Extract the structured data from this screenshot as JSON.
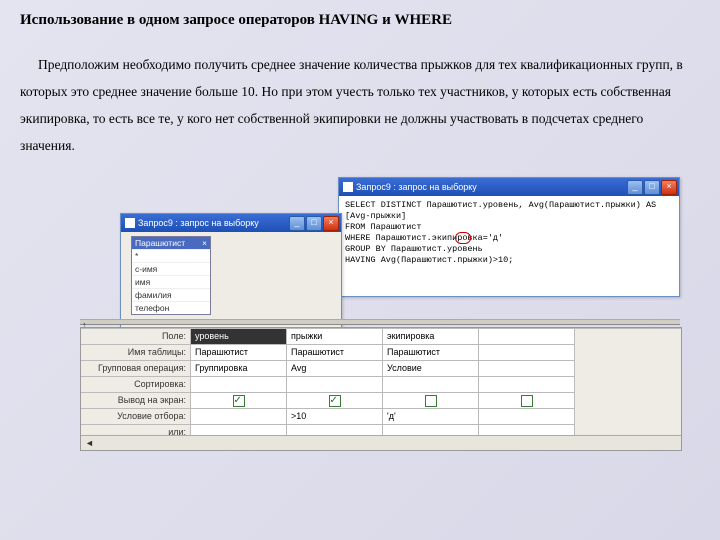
{
  "title": "Использование в одном запросе операторов HAVING и WHERE",
  "paragraph": "Предположим необходимо получить среднее значение количества прыжков для тех квалификационных групп, в которых это среднее значение больше 10. Но при этом учесть только тех участников, у которых есть собственная экипировка, то есть все те, у кого нет собственной экипировки не должны участвовать в подсчетах среднего значения.",
  "sql_window": {
    "title": "Запрос9 : запрос на выборку",
    "sql": "SELECT DISTINCT Парашютист.уровень, Avg(Парашютист.прыжки) AS [Avg-прыжки]\nFROM Парашютист\nWHERE Парашютист.экипировка='д'\nGROUP BY Парашютист.уровень\nHAVING Avg(Парашютист.прыжки)>10;"
  },
  "design_window": {
    "title": "Запрос9 : запрос на выборку",
    "table_name": "Парашютист",
    "fields": [
      "*",
      "с-имя",
      "имя",
      "фамилия",
      "телефон"
    ]
  },
  "grid": {
    "row_labels": [
      "Поле:",
      "Имя таблицы:",
      "Групповая операция:",
      "Сортировка:",
      "Вывод на экран:",
      "Условие отбора:",
      "или:"
    ],
    "cols": [
      {
        "field": "уровень",
        "table": "Парашютист",
        "op": "Группировка",
        "sort": "",
        "show": true,
        "crit": "",
        "or": ""
      },
      {
        "field": "прыжки",
        "table": "Парашютист",
        "op": "Avg",
        "sort": "",
        "show": true,
        "crit": ">10",
        "or": ""
      },
      {
        "field": "экипировка",
        "table": "Парашютист",
        "op": "Условие",
        "sort": "",
        "show": false,
        "crit": "'д'",
        "or": ""
      },
      {
        "field": "",
        "table": "",
        "op": "",
        "sort": "",
        "show": false,
        "crit": "",
        "or": ""
      }
    ]
  },
  "winbtns": {
    "min": "_",
    "max": "□",
    "close": "×"
  }
}
